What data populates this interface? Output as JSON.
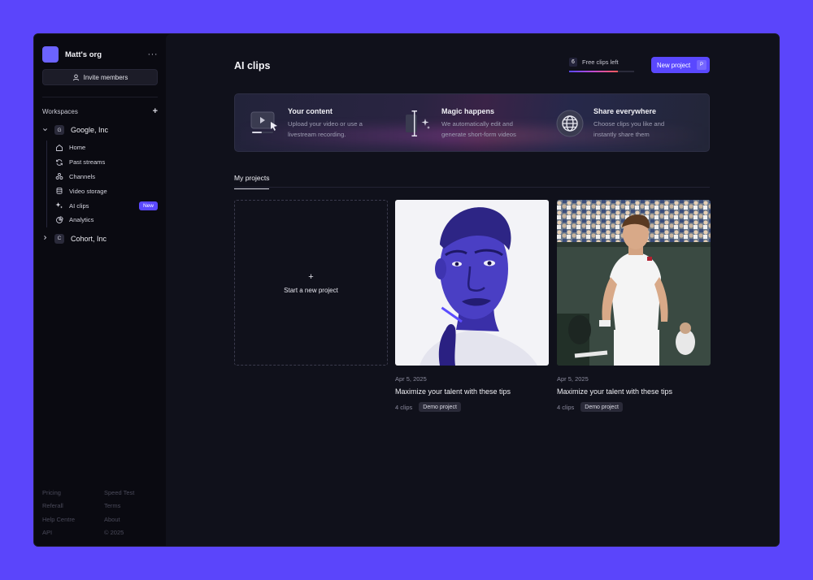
{
  "sidebar": {
    "org_name": "Matt's org",
    "more_glyph": "···",
    "invite_label": "Invite members",
    "workspaces_title": "Workspaces",
    "workspaces_add": "+",
    "workspaces": [
      {
        "badge": "G",
        "name": "Google, Inc",
        "expanded": true
      },
      {
        "badge": "C",
        "name": "Cohort, Inc",
        "expanded": false
      }
    ],
    "items": [
      {
        "label": "Home",
        "icon": "home-icon"
      },
      {
        "label": "Past streams",
        "icon": "refresh-icon"
      },
      {
        "label": "Channels",
        "icon": "channels-icon"
      },
      {
        "label": "Video storage",
        "icon": "database-icon"
      },
      {
        "label": "AI clips",
        "icon": "sparkles-icon",
        "badge": "New"
      },
      {
        "label": "Analytics",
        "icon": "pie-chart-icon"
      }
    ],
    "footer": [
      "Pricing",
      "Speed Test",
      "Referall",
      "Terms",
      "Help Centre",
      "About",
      "API",
      "© 2025"
    ]
  },
  "header": {
    "title": "AI clips",
    "free_clips_count": "6",
    "free_clips_label": "Free clips left",
    "free_clips_progress": 0.75,
    "new_project_label": "New project",
    "new_project_shortcut": "P"
  },
  "banner": {
    "features": [
      {
        "icon": "video-cursor-icon",
        "title": "Your content",
        "desc": "Upload your video or use a livestream recording."
      },
      {
        "icon": "magic-edit-icon",
        "title": "Magic happens",
        "desc": "We automatically edit and generate short-form videos"
      },
      {
        "icon": "globe-icon",
        "title": "Share everywhere",
        "desc": "Choose clips you like and instantly share them"
      }
    ]
  },
  "tabs": {
    "active": "My projects"
  },
  "projects": {
    "new_plus": "+",
    "new_label": "Start a new project",
    "items": [
      {
        "date": "Apr 5, 2025",
        "title": "Maximize your talent with these tips",
        "clips": "4 clips",
        "tag": "Demo project"
      },
      {
        "date": "Apr 5, 2025",
        "title": "Maximize your talent with these tips",
        "clips": "4 clips",
        "tag": "Demo project"
      }
    ]
  },
  "colors": {
    "accent": "#5a48ff",
    "background": "#5b45fb",
    "panel": "#10111b"
  }
}
